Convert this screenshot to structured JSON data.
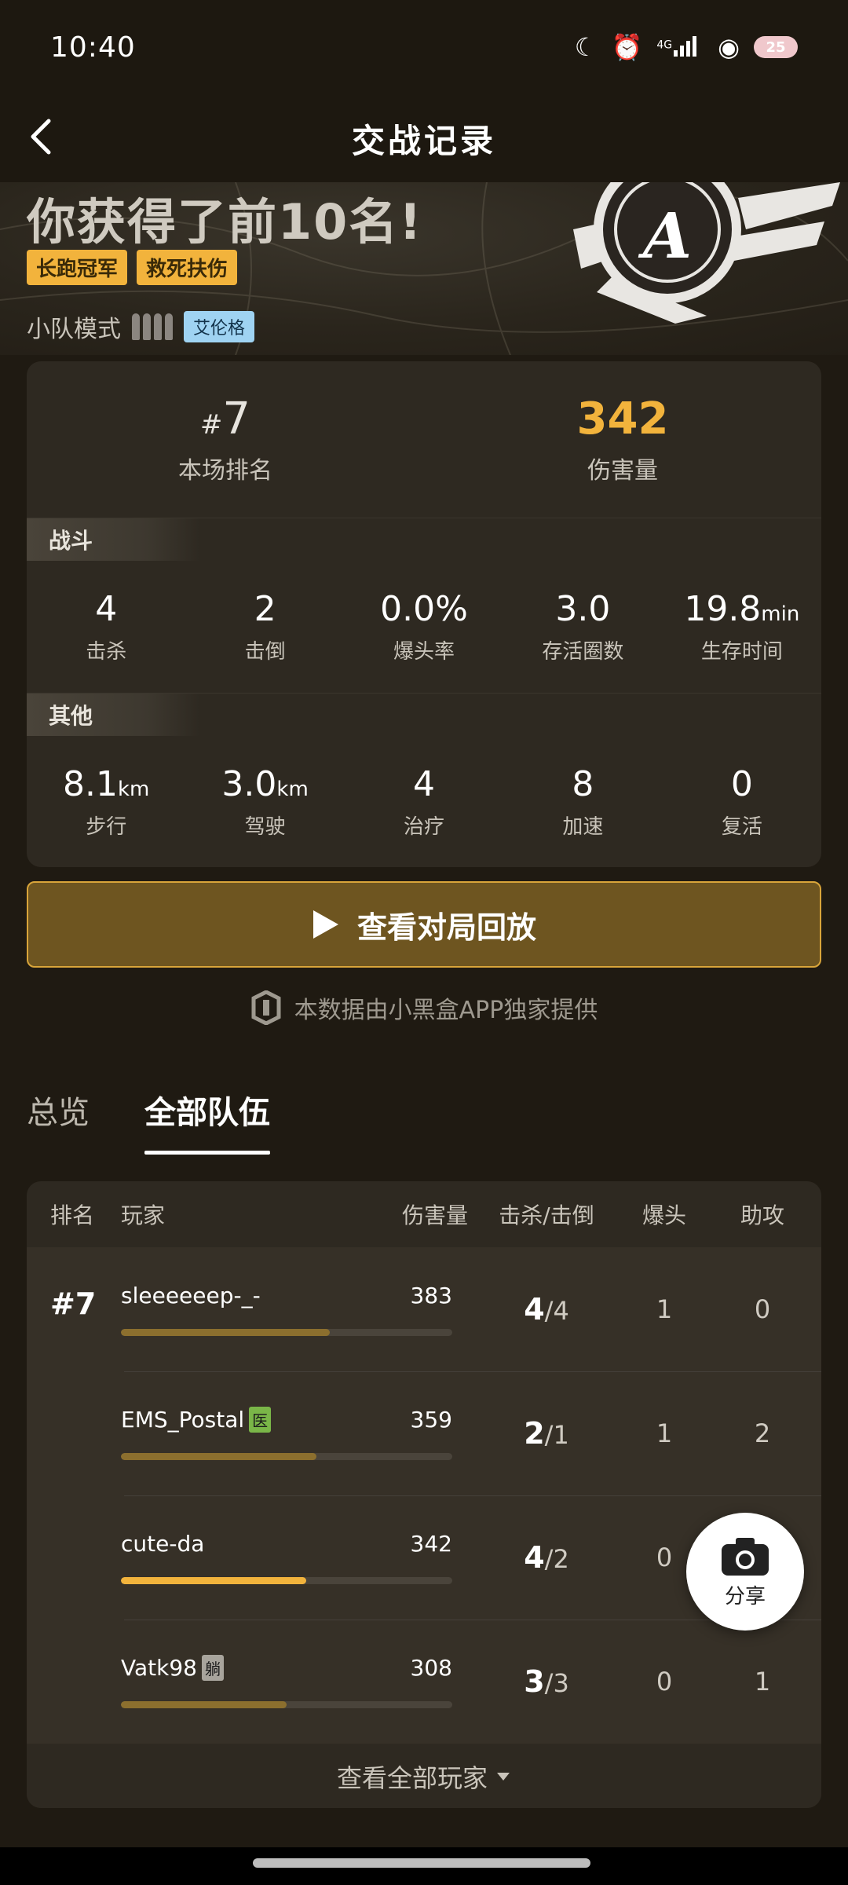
{
  "status_bar": {
    "time": "10:40",
    "network": "4G",
    "battery": "25",
    "icons": [
      "moon-icon",
      "alarm-icon",
      "signal-icon",
      "wifi-icon",
      "battery-icon"
    ]
  },
  "header": {
    "title": "交战记录"
  },
  "hero": {
    "title": "你获得了前10名!",
    "tags": [
      "长跑冠军",
      "救死扶伤"
    ],
    "mode_label": "小队模式",
    "map_tag": "艾伦格",
    "rank_badge_letter": "A"
  },
  "summary": {
    "rank_value": "7",
    "rank_label": "本场排名",
    "damage_value": "342",
    "damage_label": "伤害量"
  },
  "combat": {
    "title": "战斗",
    "stats": [
      {
        "value": "4",
        "unit": "",
        "label": "击杀"
      },
      {
        "value": "2",
        "unit": "",
        "label": "击倒"
      },
      {
        "value": "0.0%",
        "unit": "",
        "label": "爆头率"
      },
      {
        "value": "3.0",
        "unit": "",
        "label": "存活圈数"
      },
      {
        "value": "19.8",
        "unit": "min",
        "label": "生存时间"
      }
    ]
  },
  "other": {
    "title": "其他",
    "stats": [
      {
        "value": "8.1",
        "unit": "km",
        "label": "步行"
      },
      {
        "value": "3.0",
        "unit": "km",
        "label": "驾驶"
      },
      {
        "value": "4",
        "unit": "",
        "label": "治疗"
      },
      {
        "value": "8",
        "unit": "",
        "label": "加速"
      },
      {
        "value": "0",
        "unit": "",
        "label": "复活"
      }
    ]
  },
  "replay_button": "查看对局回放",
  "source_text": "本数据由小黑盒APP独家提供",
  "tabs": [
    {
      "label": "总览",
      "active": false
    },
    {
      "label": "全部队伍",
      "active": true
    }
  ],
  "team_table": {
    "headers": {
      "rank": "排名",
      "player": "玩家",
      "damage": "伤害量",
      "kd": "击杀/击倒",
      "headshot": "爆头",
      "assist": "助攻"
    },
    "rank": "#7",
    "players": [
      {
        "name": "sleeeeeep-_-",
        "badge": "",
        "badge_color": "",
        "damage": "383",
        "bar_pct": 63,
        "bar_color": "#8c6f2e",
        "kills": "4",
        "knocks": "/4",
        "headshots": "1",
        "assists": "0"
      },
      {
        "name": "EMS_Postal",
        "badge": "医",
        "badge_color": "#7ab648",
        "damage": "359",
        "bar_pct": 59,
        "bar_color": "#8c6f2e",
        "kills": "2",
        "knocks": "/1",
        "headshots": "1",
        "assists": "2"
      },
      {
        "name": "cute-da",
        "badge": "",
        "badge_color": "",
        "damage": "342",
        "bar_pct": 56,
        "bar_color": "#f2b33c",
        "kills": "4",
        "knocks": "/2",
        "headshots": "0",
        "assists": ""
      },
      {
        "name": "Vatk98",
        "badge": "躺",
        "badge_color": "#a8a49c",
        "damage": "308",
        "bar_pct": 50,
        "bar_color": "#8c6f2e",
        "kills": "3",
        "knocks": "/3",
        "headshots": "0",
        "assists": "1"
      }
    ],
    "view_all": "查看全部玩家"
  },
  "share_button": "分享"
}
